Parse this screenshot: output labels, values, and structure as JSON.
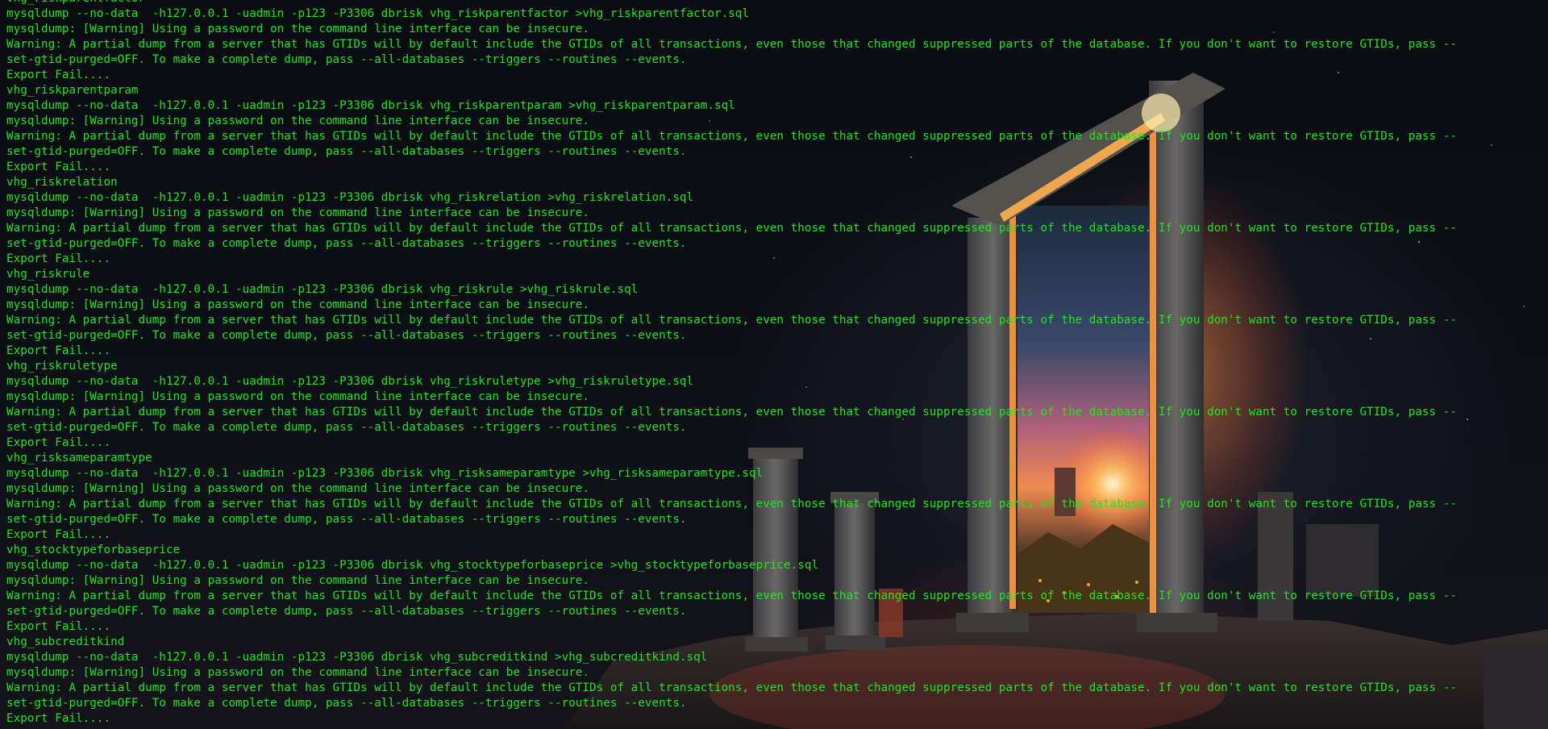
{
  "terminal": {
    "colors": {
      "text": "#1ee61e",
      "background": "#0b0d14"
    },
    "wallpaper": "ancient-stone-portal-glowing",
    "lines": [
      "vhg_riskparentfactor",
      "mysqldump --no-data  -h127.0.0.1 -uadmin -p123 -P3306 dbrisk vhg_riskparentfactor >vhg_riskparentfactor.sql",
      "mysqldump: [Warning] Using a password on the command line interface can be insecure.",
      "Warning: A partial dump from a server that has GTIDs will by default include the GTIDs of all transactions, even those that changed suppressed parts of the database. If you don't want to restore GTIDs, pass --",
      "set-gtid-purged=OFF. To make a complete dump, pass --all-databases --triggers --routines --events.",
      "Export Fail....",
      "vhg_riskparentparam",
      "mysqldump --no-data  -h127.0.0.1 -uadmin -p123 -P3306 dbrisk vhg_riskparentparam >vhg_riskparentparam.sql",
      "mysqldump: [Warning] Using a password on the command line interface can be insecure.",
      "Warning: A partial dump from a server that has GTIDs will by default include the GTIDs of all transactions, even those that changed suppressed parts of the database. If you don't want to restore GTIDs, pass --",
      "set-gtid-purged=OFF. To make a complete dump, pass --all-databases --triggers --routines --events.",
      "Export Fail....",
      "vhg_riskrelation",
      "mysqldump --no-data  -h127.0.0.1 -uadmin -p123 -P3306 dbrisk vhg_riskrelation >vhg_riskrelation.sql",
      "mysqldump: [Warning] Using a password on the command line interface can be insecure.",
      "Warning: A partial dump from a server that has GTIDs will by default include the GTIDs of all transactions, even those that changed suppressed parts of the database. If you don't want to restore GTIDs, pass --",
      "set-gtid-purged=OFF. To make a complete dump, pass --all-databases --triggers --routines --events.",
      "Export Fail....",
      "vhg_riskrule",
      "mysqldump --no-data  -h127.0.0.1 -uadmin -p123 -P3306 dbrisk vhg_riskrule >vhg_riskrule.sql",
      "mysqldump: [Warning] Using a password on the command line interface can be insecure.",
      "Warning: A partial dump from a server that has GTIDs will by default include the GTIDs of all transactions, even those that changed suppressed parts of the database. If you don't want to restore GTIDs, pass --",
      "set-gtid-purged=OFF. To make a complete dump, pass --all-databases --triggers --routines --events.",
      "Export Fail....",
      "vhg_riskruletype",
      "mysqldump --no-data  -h127.0.0.1 -uadmin -p123 -P3306 dbrisk vhg_riskruletype >vhg_riskruletype.sql",
      "mysqldump: [Warning] Using a password on the command line interface can be insecure.",
      "Warning: A partial dump from a server that has GTIDs will by default include the GTIDs of all transactions, even those that changed suppressed parts of the database. If you don't want to restore GTIDs, pass --",
      "set-gtid-purged=OFF. To make a complete dump, pass --all-databases --triggers --routines --events.",
      "Export Fail....",
      "vhg_risksameparamtype",
      "mysqldump --no-data  -h127.0.0.1 -uadmin -p123 -P3306 dbrisk vhg_risksameparamtype >vhg_risksameparamtype.sql",
      "mysqldump: [Warning] Using a password on the command line interface can be insecure.",
      "Warning: A partial dump from a server that has GTIDs will by default include the GTIDs of all transactions, even those that changed suppressed parts of the database. If you don't want to restore GTIDs, pass --",
      "set-gtid-purged=OFF. To make a complete dump, pass --all-databases --triggers --routines --events.",
      "Export Fail....",
      "vhg_stocktypeforbaseprice",
      "mysqldump --no-data  -h127.0.0.1 -uadmin -p123 -P3306 dbrisk vhg_stocktypeforbaseprice >vhg_stocktypeforbaseprice.sql",
      "mysqldump: [Warning] Using a password on the command line interface can be insecure.",
      "Warning: A partial dump from a server that has GTIDs will by default include the GTIDs of all transactions, even those that changed suppressed parts of the database. If you don't want to restore GTIDs, pass --",
      "set-gtid-purged=OFF. To make a complete dump, pass --all-databases --triggers --routines --events.",
      "Export Fail....",
      "vhg_subcreditkind",
      "mysqldump --no-data  -h127.0.0.1 -uadmin -p123 -P3306 dbrisk vhg_subcreditkind >vhg_subcreditkind.sql",
      "mysqldump: [Warning] Using a password on the command line interface can be insecure.",
      "Warning: A partial dump from a server that has GTIDs will by default include the GTIDs of all transactions, even those that changed suppressed parts of the database. If you don't want to restore GTIDs, pass --",
      "set-gtid-purged=OFF. To make a complete dump, pass --all-databases --triggers --routines --events.",
      "Export Fail...."
    ]
  }
}
